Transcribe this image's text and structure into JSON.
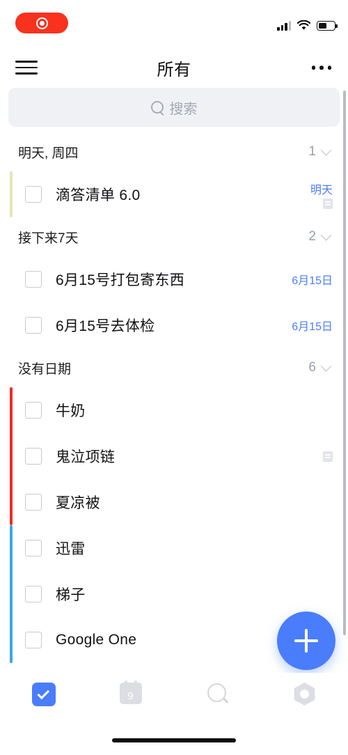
{
  "status_bar": {
    "recording_indicator": "screen-recording-active",
    "signal_icon": "cellular-signal-icon",
    "signal_bars_filled": 3,
    "signal_bars_total": 4,
    "wifi_icon": "wifi-icon",
    "battery_icon": "battery-icon",
    "battery_level_percent": 52
  },
  "navbar": {
    "menu_icon": "hamburger-menu-icon",
    "title": "所有",
    "more_icon": "more-options-icon"
  },
  "search": {
    "icon": "search-icon",
    "placeholder": "搜索",
    "value": ""
  },
  "colors": {
    "accent_blue": "#4a7dfb",
    "date_blue": "#4a7dfb",
    "priority_yellow": "#e4e3b6",
    "priority_red": "#f8281e",
    "priority_blue": "#36a8f0",
    "search_bg": "#eff1f5",
    "recording_red": "#f8321e"
  },
  "sections": [
    {
      "title": "明天, 周四",
      "count": "1",
      "collapse_icon": "chevron-down-icon",
      "tasks": [
        {
          "title": "滴答清单 6.0",
          "date": "明天",
          "has_note": true,
          "rail_color": "#e4e3b6",
          "checked": false
        }
      ]
    },
    {
      "title": "接下来7天",
      "count": "2",
      "collapse_icon": "chevron-down-icon",
      "tasks": [
        {
          "title": "6月15号打包寄东西",
          "date": "6月15日",
          "has_note": false,
          "rail_color": null,
          "checked": false
        },
        {
          "title": "6月15号去体检",
          "date": "6月15日",
          "has_note": false,
          "rail_color": null,
          "checked": false
        }
      ]
    },
    {
      "title": "没有日期",
      "count": "6",
      "collapse_icon": "chevron-down-icon",
      "tasks": [
        {
          "title": "牛奶",
          "date": "",
          "has_note": false,
          "rail_color": "#f8281e",
          "checked": false
        },
        {
          "title": "鬼泣项链",
          "date": "",
          "has_note": true,
          "rail_color": "#f8281e",
          "checked": false
        },
        {
          "title": "夏凉被",
          "date": "",
          "has_note": false,
          "rail_color": "#f8281e",
          "checked": false
        },
        {
          "title": "迅雷",
          "date": "",
          "has_note": false,
          "rail_color": "#36a8f0",
          "checked": false
        },
        {
          "title": "梯子",
          "date": "",
          "has_note": false,
          "rail_color": "#36a8f0",
          "checked": false
        },
        {
          "title": "Google  One",
          "date": "",
          "has_note": false,
          "rail_color": "#36a8f0",
          "checked": false
        }
      ]
    }
  ],
  "fab": {
    "icon": "plus-icon",
    "label": "添加任务"
  },
  "tabbar": {
    "items": [
      {
        "icon": "task-checkbox-icon",
        "name": "tasks",
        "active": true,
        "badge": ""
      },
      {
        "icon": "calendar-icon",
        "name": "calendar",
        "active": false,
        "badge": "9"
      },
      {
        "icon": "search-icon",
        "name": "search",
        "active": false,
        "badge": ""
      },
      {
        "icon": "settings-gear-icon",
        "name": "settings",
        "active": false,
        "badge": ""
      }
    ]
  },
  "home_indicator": "home-indicator"
}
